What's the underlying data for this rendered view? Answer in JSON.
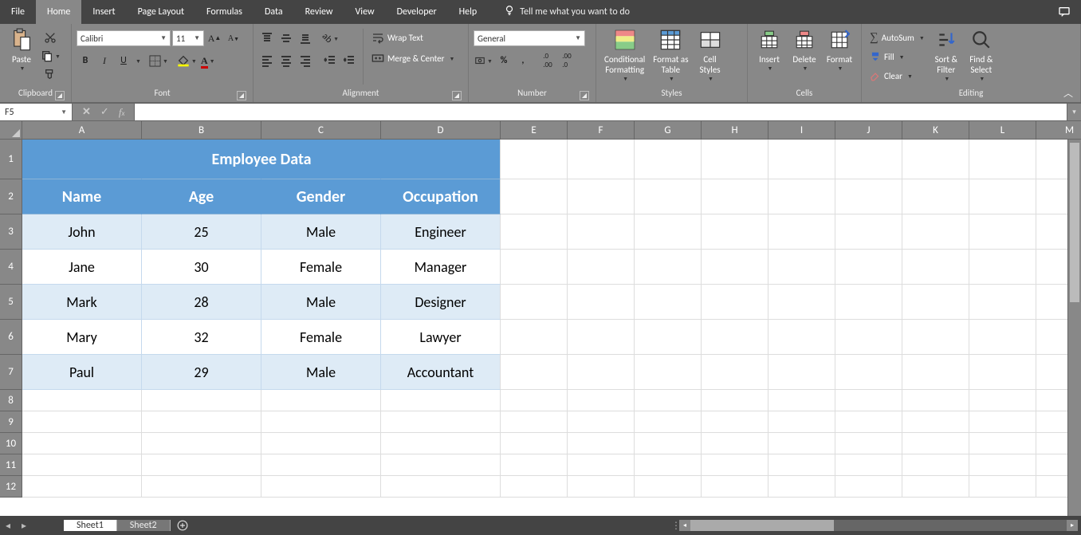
{
  "tabs": {
    "file": "File",
    "home": "Home",
    "insert": "Insert",
    "page_layout": "Page Layout",
    "formulas": "Formulas",
    "data": "Data",
    "review": "Review",
    "view": "View",
    "developer": "Developer",
    "help": "Help",
    "tell_me": "Tell me what you want to do"
  },
  "ribbon": {
    "clipboard": {
      "label": "Clipboard",
      "paste": "Paste"
    },
    "font": {
      "label": "Font",
      "name": "Calibri",
      "size": "11",
      "bold": "B",
      "italic": "I",
      "underline": "U"
    },
    "alignment": {
      "label": "Alignment",
      "wrap": "Wrap Text",
      "merge": "Merge & Center"
    },
    "number": {
      "label": "Number",
      "format": "General"
    },
    "styles": {
      "label": "Styles",
      "cond": "Conditional\nFormatting",
      "table": "Format as\nTable",
      "cell": "Cell\nStyles"
    },
    "cells": {
      "label": "Cells",
      "insert": "Insert",
      "delete": "Delete",
      "format": "Format"
    },
    "editing": {
      "label": "Editing",
      "autosum": "AutoSum",
      "fill": "Fill",
      "clear": "Clear",
      "sort": "Sort &\nFilter",
      "find": "Find &\nSelect"
    }
  },
  "namebox": "F5",
  "columns": [
    "A",
    "B",
    "C",
    "D",
    "E",
    "F",
    "G",
    "H",
    "I",
    "J",
    "K",
    "L",
    "M"
  ],
  "rows": [
    "1",
    "2",
    "3",
    "4",
    "5",
    "6",
    "7",
    "8",
    "9",
    "10",
    "11",
    "12"
  ],
  "wide_cols": 4,
  "table": {
    "title": "Employee Data",
    "headers": [
      "Name",
      "Age",
      "Gender",
      "Occupation"
    ],
    "data": [
      [
        "John",
        "25",
        "Male",
        "Engineer"
      ],
      [
        "Jane",
        "30",
        "Female",
        "Manager"
      ],
      [
        "Mark",
        "28",
        "Male",
        "Designer"
      ],
      [
        "Mary",
        "32",
        "Female",
        "Lawyer"
      ],
      [
        "Paul",
        "29",
        "Male",
        "Accountant"
      ]
    ]
  },
  "sheets": {
    "active": "Sheet1",
    "other": "Sheet2"
  }
}
